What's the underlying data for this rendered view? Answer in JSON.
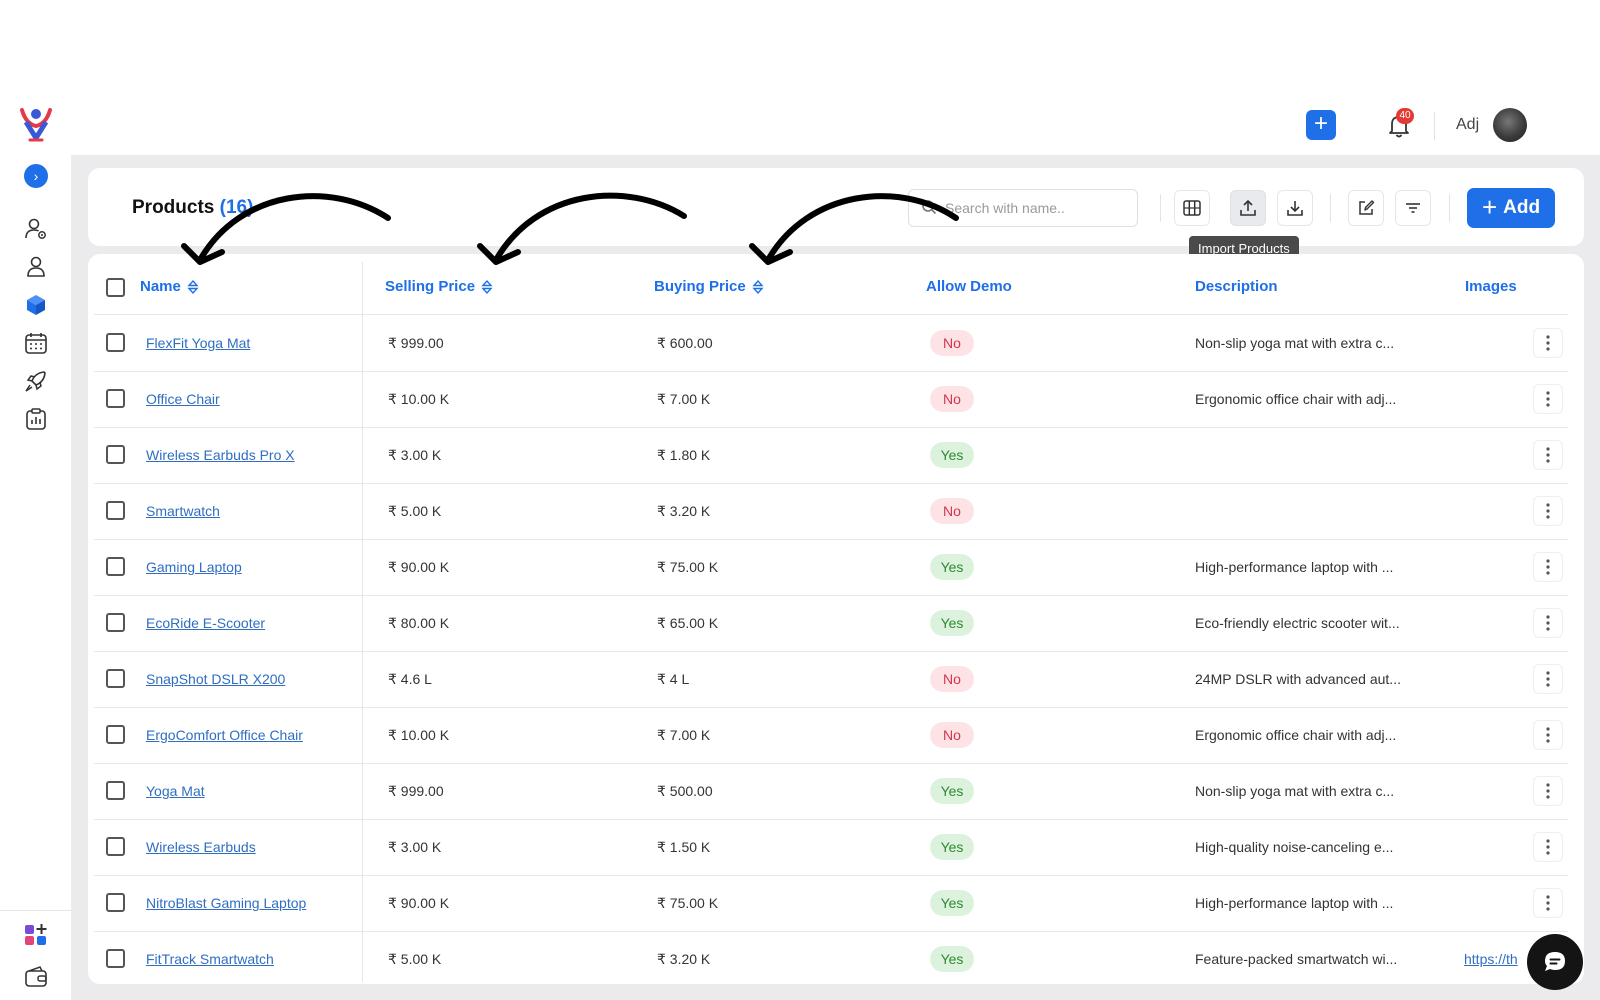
{
  "header": {
    "notification_count": "40",
    "user_name": "Adj"
  },
  "page": {
    "title": "Products",
    "count": "(16)"
  },
  "toolbar": {
    "search_placeholder": "Search with name..",
    "tooltip": "Import Products",
    "add_label": "Add"
  },
  "table": {
    "columns": {
      "name": "Name",
      "selling_price": "Selling Price",
      "buying_price": "Buying Price",
      "allow_demo": "Allow Demo",
      "description": "Description",
      "images": "Images"
    },
    "rows": [
      {
        "name": "FlexFit Yoga Mat",
        "selling": "₹ 999.00",
        "buying": "₹ 600.00",
        "demo": "No",
        "description": "Non-slip yoga mat with extra c...",
        "images": ""
      },
      {
        "name": "Office Chair",
        "selling": "₹ 10.00 K",
        "buying": "₹ 7.00 K",
        "demo": "No",
        "description": "Ergonomic office chair with adj...",
        "images": ""
      },
      {
        "name": "Wireless Earbuds Pro X",
        "selling": "₹ 3.00 K",
        "buying": "₹ 1.80 K",
        "demo": "Yes",
        "description": "",
        "images": ""
      },
      {
        "name": "Smartwatch",
        "selling": "₹ 5.00 K",
        "buying": "₹ 3.20 K",
        "demo": "No",
        "description": "",
        "images": ""
      },
      {
        "name": "Gaming Laptop",
        "selling": "₹ 90.00 K",
        "buying": "₹ 75.00 K",
        "demo": "Yes",
        "description": "High-performance laptop with ...",
        "images": ""
      },
      {
        "name": "EcoRide E-Scooter",
        "selling": "₹ 80.00 K",
        "buying": "₹ 65.00 K",
        "demo": "Yes",
        "description": "Eco-friendly electric scooter wit...",
        "images": ""
      },
      {
        "name": "SnapShot DSLR X200",
        "selling": "₹ 4.6 L",
        "buying": "₹ 4 L",
        "demo": "No",
        "description": "24MP DSLR with advanced aut...",
        "images": ""
      },
      {
        "name": "ErgoComfort Office Chair",
        "selling": "₹ 10.00 K",
        "buying": "₹ 7.00 K",
        "demo": "No",
        "description": "Ergonomic office chair with adj...",
        "images": ""
      },
      {
        "name": "Yoga Mat",
        "selling": "₹ 999.00",
        "buying": "₹ 500.00",
        "demo": "Yes",
        "description": "Non-slip yoga mat with extra c...",
        "images": ""
      },
      {
        "name": "Wireless Earbuds",
        "selling": "₹ 3.00 K",
        "buying": "₹ 1.50 K",
        "demo": "Yes",
        "description": "High-quality noise-canceling e...",
        "images": ""
      },
      {
        "name": "NitroBlast Gaming Laptop",
        "selling": "₹ 90.00 K",
        "buying": "₹ 75.00 K",
        "demo": "Yes",
        "description": "High-performance laptop with ...",
        "images": ""
      },
      {
        "name": "FitTrack Smartwatch",
        "selling": "₹ 5.00 K",
        "buying": "₹ 3.20 K",
        "demo": "Yes",
        "description": "Feature-packed smartwatch wi...",
        "images": "https://th"
      }
    ]
  },
  "colors": {
    "accent": "#1e6fe8",
    "no_badge": "#fde3e6",
    "yes_badge": "#dcf2dc"
  }
}
